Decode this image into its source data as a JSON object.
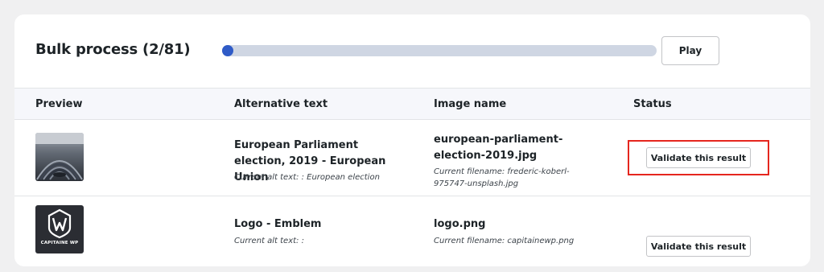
{
  "bulk": {
    "title": "Bulk process (2/81)",
    "progress": 0.02,
    "play_label": "Play"
  },
  "colors": {
    "accent": "#2f5bc7",
    "highlight": "#e5261e"
  },
  "table": {
    "columns": [
      "Preview",
      "Alternative text",
      "Image name",
      "Status"
    ],
    "rows": [
      {
        "preview_icon": "parliament-hemicycle-thumbnail",
        "alt_text": "European Parliament election, 2019 - European Union",
        "current_alt_label": "Current alt text: : European election",
        "image_name": "european-parliament-election-2019.jpg",
        "current_filename_label": "Current filename: frederic-koberl-975747-unsplash.jpg",
        "action_label": "Validate this result"
      },
      {
        "preview_icon": "capitaine-wp-logo",
        "logo_text": "CAPITAINE WP",
        "alt_text": "Logo - Emblem",
        "current_alt_label": "Current alt text: :",
        "image_name": "logo.png",
        "current_filename_label": "Current filename: capitainewp.png",
        "action_label": "Validate this result"
      }
    ]
  }
}
